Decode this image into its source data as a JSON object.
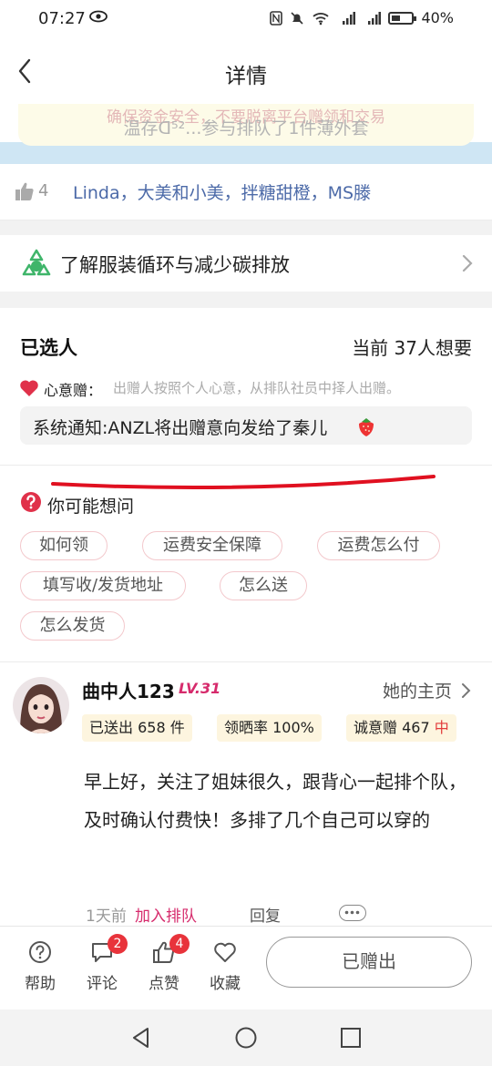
{
  "status_bar": {
    "time": "07:27",
    "battery": "40%"
  },
  "header": {
    "title": "详情"
  },
  "banner": {
    "warning": "确保资金安全，不要脱离平台赠领和交易",
    "notice": "温存ᗡ⁵²...参与排队了1件薄外套"
  },
  "likes": {
    "count": "4",
    "names": "Linda，大美和小美，拌糖甜橙，MS滕"
  },
  "recycle": {
    "label": "了解服装循环与减少碳排放"
  },
  "selected": {
    "heading": "已选人",
    "current": "当前 37人想要",
    "xinyi_label": "心意赠：",
    "xinyi_desc": "出赠人按照个人心意，从排队社员中择人出赠。",
    "notification": "系统通知:ANZL将出赠意向发给了秦儿"
  },
  "faq": {
    "heading": "你可能想问",
    "chips": [
      "如何领",
      "运费安全保障",
      "运费怎么付",
      "填写收/发货地址",
      "怎么送",
      "怎么发货"
    ]
  },
  "comment": {
    "username": "曲中人123",
    "level": "LV.31",
    "homepage": "她的主页",
    "stats": {
      "sent_label": "已送出",
      "sent_value": "658 件",
      "rate_label": "领晒率",
      "rate_value": "100%",
      "sincere_label": "诚意赠",
      "sincere_value": "467",
      "sincere_level": "中"
    },
    "text": "早上好，关注了姐妹很久，跟背心一起排个队，及时确认付费快！多排了几个自己可以穿的",
    "time": "1天前",
    "action": "加入排队",
    "reply": "回复"
  },
  "bottom_bar": {
    "help": "帮助",
    "comment": "评论",
    "comment_badge": "2",
    "like": "点赞",
    "like_badge": "4",
    "favorite": "收藏",
    "donated_button": "已赠出"
  },
  "colors": {
    "accent_pink": "#d62b6c",
    "link_blue": "#4c6aa8",
    "badge_red": "#e8333b",
    "chip_border": "#f3c8cc"
  }
}
